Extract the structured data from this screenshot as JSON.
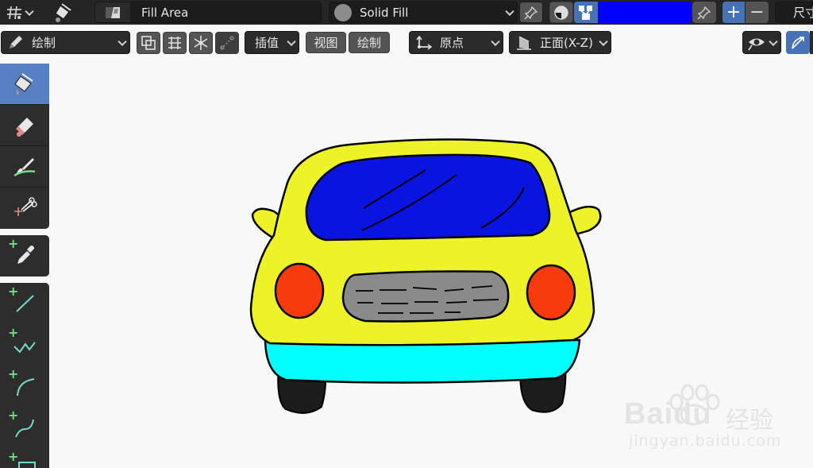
{
  "header": {
    "tool_name": "Fill Area",
    "material_name": "Solid Fill",
    "size_label": "尺寸"
  },
  "colors": {
    "fill_swatch": "#0000ff",
    "accent": "#4772b3",
    "active_tool": "#5680c2"
  },
  "toolbar2": {
    "mode_label": "绘制",
    "interp_label": "插值",
    "view_label": "视图",
    "draw_label": "绘制",
    "origin_label": "原点",
    "view_axis_label": "正面(X-Z)"
  },
  "watermark": {
    "brand": "Baidu",
    "cn": "经验",
    "url": "jingyan.baidu.com"
  },
  "tools": [
    {
      "name": "fill-tool",
      "icon": "paint-bucket-icon"
    },
    {
      "name": "erase-tool",
      "icon": "eraser-icon"
    },
    {
      "name": "tint-tool",
      "icon": "brush-icon"
    },
    {
      "name": "cutter-tool",
      "icon": "scissors-icon"
    },
    {
      "name": "eyedropper-tool",
      "icon": "eyedropper-icon"
    },
    {
      "name": "line-tool",
      "icon": "line-icon"
    },
    {
      "name": "polyline-tool",
      "icon": "polyline-icon"
    },
    {
      "name": "arc-tool",
      "icon": "arc-icon"
    },
    {
      "name": "curve-tool",
      "icon": "curve-icon"
    },
    {
      "name": "box-tool",
      "icon": "box-icon"
    }
  ]
}
